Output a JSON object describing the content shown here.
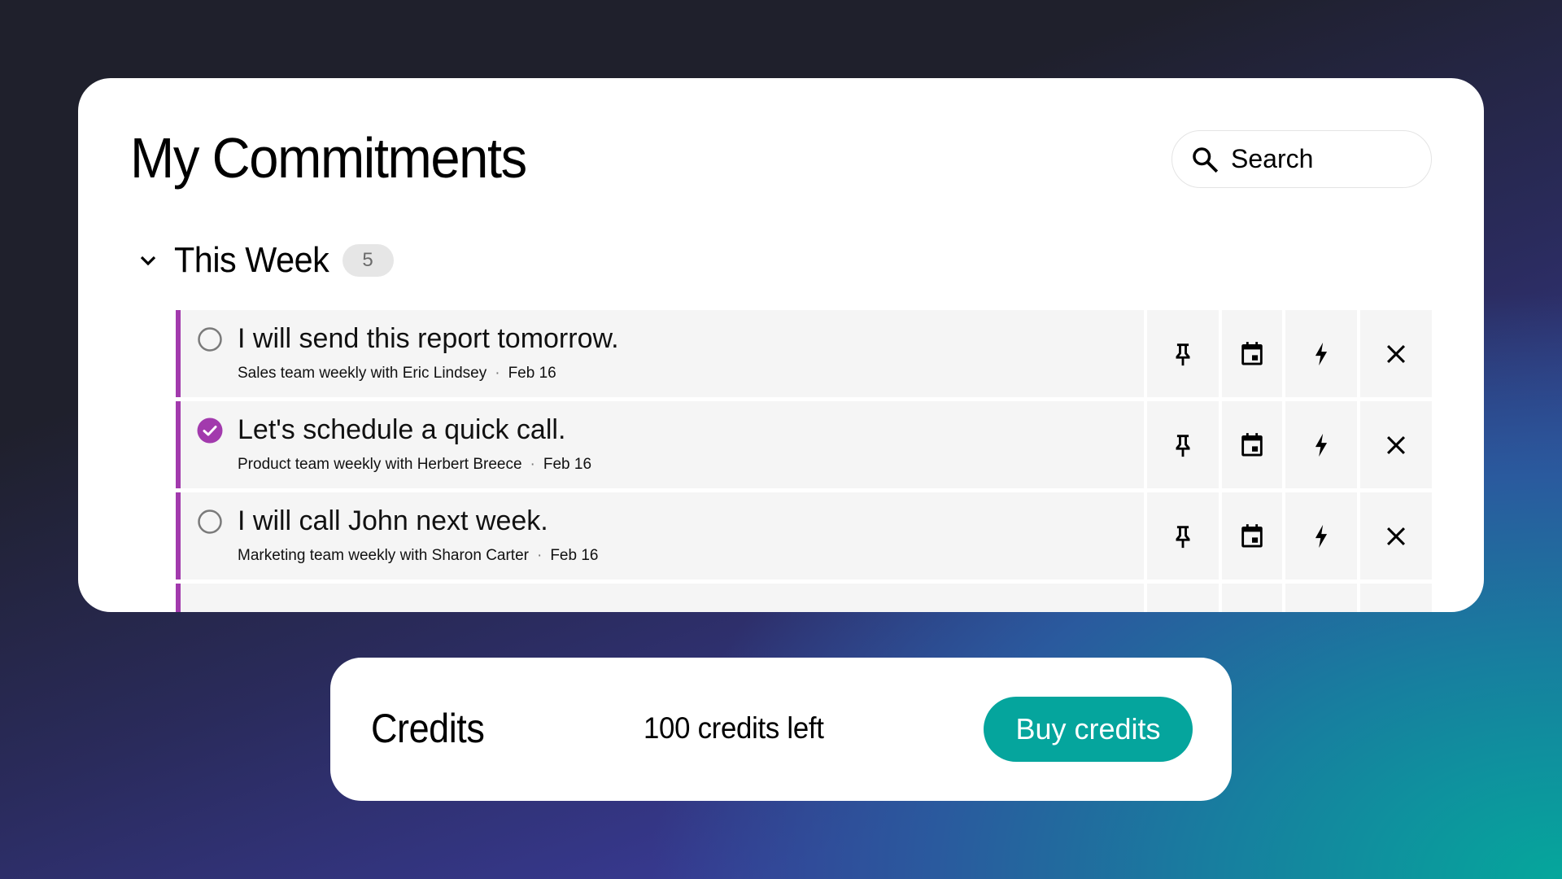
{
  "header": {
    "title": "My Commitments",
    "search": {
      "placeholder": "Search",
      "value": "",
      "icon": "search-icon"
    }
  },
  "section": {
    "title": "This Week",
    "count": "5",
    "expanded": true,
    "icon": "chevron-down-icon"
  },
  "commitments": [
    {
      "title": "I will send this report tomorrow.",
      "meeting": "Sales team weekly with Eric Lindsey",
      "separator": "·",
      "date": "Feb 16",
      "completed": false
    },
    {
      "title": "Let's schedule a quick call.",
      "meeting": "Product team weekly with Herbert Breece",
      "separator": "·",
      "date": "Feb 16",
      "completed": true
    },
    {
      "title": "I will call John next week.",
      "meeting": "Marketing team weekly with Sharon Carter",
      "separator": "·",
      "date": "Feb 16",
      "completed": false
    },
    {
      "title": "",
      "meeting": "",
      "separator": "",
      "date": "",
      "completed": false
    }
  ],
  "row_actions": [
    {
      "name": "pin",
      "icon": "pin-icon"
    },
    {
      "name": "schedule",
      "icon": "calendar-icon"
    },
    {
      "name": "boost",
      "icon": "lightning-bolt-icon"
    },
    {
      "name": "dismiss",
      "icon": "close-icon"
    }
  ],
  "credits": {
    "title": "Credits",
    "remaining_label": "100 credits left",
    "buy_label": "Buy credits"
  },
  "colors": {
    "accent": "#a23aad",
    "button": "#05a59d",
    "background_dark": "#1f202c",
    "row_background": "#f5f5f5"
  }
}
